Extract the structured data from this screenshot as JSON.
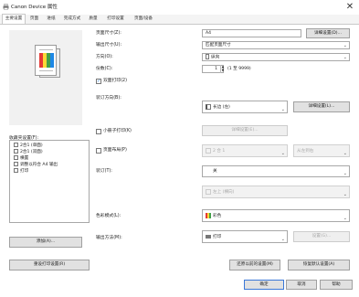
{
  "window": {
    "title": "Canon Device 属性",
    "close_glyph": "✕"
  },
  "tabs": [
    {
      "label": "主要设置"
    },
    {
      "label": "页面"
    },
    {
      "label": "进纸"
    },
    {
      "label": "完成方式"
    },
    {
      "label": "质量"
    },
    {
      "label": "打印设置"
    },
    {
      "label": "页面/设备"
    }
  ],
  "favorites": {
    "label": "收藏夹设置(F):",
    "items": [
      {
        "label": "2合1 (单面)"
      },
      {
        "label": "2合1 (双面)"
      },
      {
        "label": "横置"
      },
      {
        "label": "调整以符合 A4 输出"
      },
      {
        "label": "打印"
      }
    ],
    "add_button": "添加(A)...",
    "reset_button": "重设打印设置(R)"
  },
  "settings": {
    "page_size": {
      "label": "页面尺寸(Z):",
      "value": "A4",
      "button": "详细设置(D)..."
    },
    "output_size": {
      "label": "输出尺寸(U):",
      "value": "匹配页面尺寸"
    },
    "orientation": {
      "label": "方向(O):",
      "value": "纵向"
    },
    "copies": {
      "label": "份数(C):",
      "value": "1",
      "range": "(1 至 9999)"
    },
    "duplex": {
      "checkbox_label": "双面打印(2)",
      "checked": true
    },
    "binding": {
      "label": "装订方向(B):",
      "value": "长边 (左)",
      "button": "详细设置(L)..."
    },
    "booklet": {
      "checkbox_label": "小册子打印(K)",
      "checked": false,
      "button": "详细设置(E)..."
    },
    "page_layout": {
      "checkbox_label": "页面布局(P)",
      "checked": false,
      "value": "2 合 1",
      "order": "从左到右"
    },
    "finishing": {
      "label": "装订(T):",
      "value": "关"
    },
    "staple_position": {
      "value": "左上 (横向)"
    },
    "color_mode": {
      "label": "色彩模式(L):",
      "value": "彩色"
    },
    "output_method": {
      "label": "输出方法(M):",
      "value": "打印",
      "button": "设置(G)..."
    }
  },
  "footer": {
    "restore_button": "还原以前的设置(M)",
    "defaults_button": "恢复默认设置(A)",
    "ok": "确定",
    "cancel": "取消",
    "help": "帮助"
  },
  "colors": {
    "accent": "#3b78d8",
    "checkmark": "#2a7ad5"
  }
}
